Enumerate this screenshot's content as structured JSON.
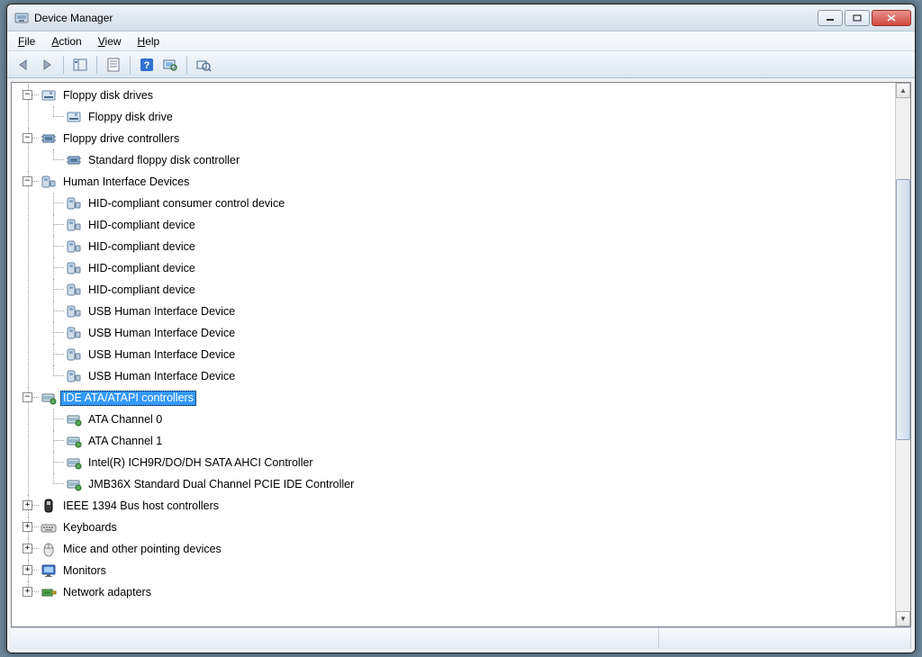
{
  "window": {
    "title": "Device Manager"
  },
  "menu": {
    "file": "File",
    "action": "Action",
    "view": "View",
    "help": "Help"
  },
  "toolbar": {
    "back": "back-icon",
    "forward": "forward-icon",
    "show_hide": "console-tree-icon",
    "properties": "properties-icon",
    "help": "help-icon",
    "scan": "scan-hardware-icon",
    "view_devices": "view-devices-icon"
  },
  "tree": [
    {
      "label": "Floppy disk drives",
      "icon": "floppy-drive-icon",
      "expanded": true,
      "children": [
        {
          "label": "Floppy disk drive",
          "icon": "floppy-drive-icon"
        }
      ]
    },
    {
      "label": "Floppy drive controllers",
      "icon": "controller-icon",
      "expanded": true,
      "children": [
        {
          "label": "Standard floppy disk controller",
          "icon": "controller-icon"
        }
      ]
    },
    {
      "label": "Human Interface Devices",
      "icon": "hid-icon",
      "expanded": true,
      "children": [
        {
          "label": "HID-compliant consumer control device",
          "icon": "hid-icon"
        },
        {
          "label": "HID-compliant device",
          "icon": "hid-icon"
        },
        {
          "label": "HID-compliant device",
          "icon": "hid-icon"
        },
        {
          "label": "HID-compliant device",
          "icon": "hid-icon"
        },
        {
          "label": "HID-compliant device",
          "icon": "hid-icon"
        },
        {
          "label": "USB Human Interface Device",
          "icon": "hid-icon"
        },
        {
          "label": "USB Human Interface Device",
          "icon": "hid-icon"
        },
        {
          "label": "USB Human Interface Device",
          "icon": "hid-icon"
        },
        {
          "label": "USB Human Interface Device",
          "icon": "hid-icon"
        }
      ]
    },
    {
      "label": "IDE ATA/ATAPI controllers",
      "icon": "ide-controller-icon",
      "expanded": true,
      "selected": true,
      "children": [
        {
          "label": "ATA Channel 0",
          "icon": "ide-controller-icon"
        },
        {
          "label": "ATA Channel 1",
          "icon": "ide-controller-icon"
        },
        {
          "label": "Intel(R) ICH9R/DO/DH SATA AHCI Controller",
          "icon": "ide-controller-icon"
        },
        {
          "label": "JMB36X Standard Dual Channel PCIE IDE Controller",
          "icon": "ide-controller-icon"
        }
      ]
    },
    {
      "label": "IEEE 1394 Bus host controllers",
      "icon": "ieee1394-icon",
      "expanded": false
    },
    {
      "label": "Keyboards",
      "icon": "keyboard-icon",
      "expanded": false
    },
    {
      "label": "Mice and other pointing devices",
      "icon": "mouse-icon",
      "expanded": false
    },
    {
      "label": "Monitors",
      "icon": "monitor-icon",
      "expanded": false
    },
    {
      "label": "Network adapters",
      "icon": "network-adapter-icon",
      "expanded": false
    }
  ],
  "icons": {
    "floppy-drive-icon": "floppy",
    "controller-icon": "chip",
    "hid-icon": "hid",
    "ide-controller-icon": "ide",
    "ieee1394-icon": "firewire",
    "keyboard-icon": "keyboard",
    "mouse-icon": "mouse",
    "monitor-icon": "monitor",
    "network-adapter-icon": "network"
  }
}
